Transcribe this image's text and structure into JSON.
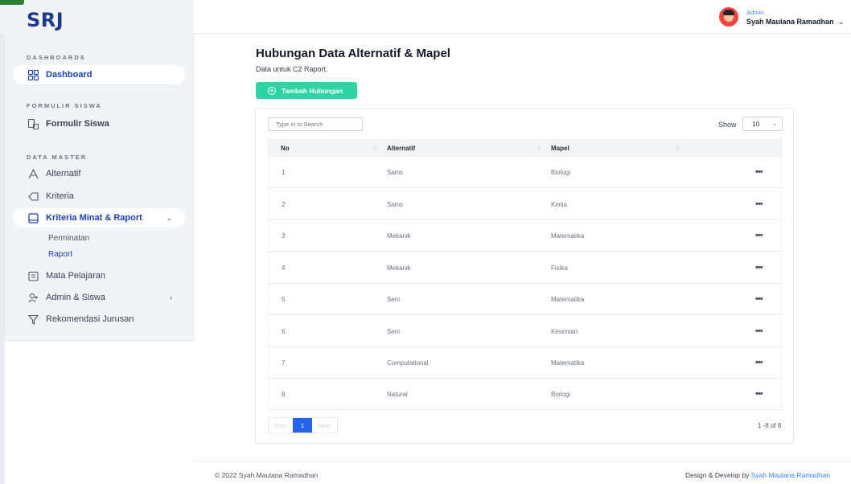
{
  "brand": {
    "logo": "SRJ"
  },
  "sidebar": {
    "sections": [
      {
        "title": "DASHBOARDS"
      },
      {
        "title": "FORMULIR SISWA"
      },
      {
        "title": "DATA MASTER"
      }
    ],
    "items": [
      {
        "label": "Dashboard",
        "icon": "grid-icon"
      },
      {
        "label": "Formulir Siswa",
        "icon": "form-icon"
      },
      {
        "label": "Alternatif",
        "icon": "letter-a-icon"
      },
      {
        "label": "Kriteria",
        "icon": "tag-icon"
      },
      {
        "label": "Kriteria Minat & Raport",
        "icon": "book-icon"
      },
      {
        "label": "Mata Pelajaran",
        "icon": "calendar-icon"
      },
      {
        "label": "Admin & Siswa",
        "icon": "user-plus-icon"
      },
      {
        "label": "Rekomendasi Jurusan",
        "icon": "filter-icon"
      }
    ],
    "subitems": [
      {
        "label": "Perminatan"
      },
      {
        "label": "Raport"
      }
    ]
  },
  "header": {
    "user_role": "Admin",
    "user_name": "Syah Maulana Ramadhan"
  },
  "page": {
    "title": "Hubungan Data Alternatif & Mapel",
    "subtitle": "Data untuk C2 Raport.",
    "add_button": "Tambah Hubungan"
  },
  "table": {
    "search_placeholder": "Type in to Search",
    "show_label": "Show",
    "show_value": "10",
    "columns": [
      "No",
      "Alternatif",
      "Mapel"
    ],
    "rows": [
      {
        "no": "1",
        "alternatif": "Sains",
        "mapel": "Biologi"
      },
      {
        "no": "2",
        "alternatif": "Sains",
        "mapel": "Kimia"
      },
      {
        "no": "3",
        "alternatif": "Mekanik",
        "mapel": "Matematika"
      },
      {
        "no": "4",
        "alternatif": "Mekanik",
        "mapel": "Fisika"
      },
      {
        "no": "5",
        "alternatif": "Seni",
        "mapel": "Matematika"
      },
      {
        "no": "6",
        "alternatif": "Seni",
        "mapel": "Kesenian"
      },
      {
        "no": "7",
        "alternatif": "Computational",
        "mapel": "Matematika"
      },
      {
        "no": "8",
        "alternatif": "Natural",
        "mapel": "Biologi"
      }
    ],
    "actions_label": "•••",
    "pagination": {
      "prev": "Prev",
      "current": "1",
      "next": "Next",
      "range": "1 -8 of 8"
    }
  },
  "footer": {
    "copyright": "© 2022 Syah Maulana Ramadhan",
    "credit_prefix": "Design & Develop by",
    "credit_link": "Syah Maulana Ramadhan"
  },
  "colors": {
    "primary": "#1e40af",
    "accent": "#2dd4a4",
    "pager_active": "#2563eb",
    "sidebar_bg": "#f1f3f6"
  }
}
